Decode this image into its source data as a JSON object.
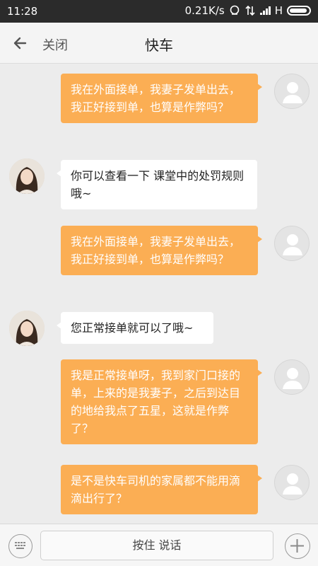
{
  "status_bar": {
    "time": "11:28",
    "network_speed": "0.21K/s",
    "network_type": "H",
    "icons": [
      "qq-icon",
      "data-arrows-icon",
      "signal-icon",
      "battery-icon"
    ]
  },
  "header": {
    "back_icon": "arrow-left-icon",
    "close_label": "关闭",
    "title": "快车"
  },
  "messages": [
    {
      "sender": "user",
      "avatar": "default-user-avatar",
      "text": "我在外面接单，我妻子发单出去，我正好接到单，也算是作弊吗？"
    },
    {
      "sender": "agent",
      "avatar": "service-agent-photo",
      "text": "你可以查看一下 课堂中的处罚规则哦~"
    },
    {
      "sender": "user",
      "avatar": "default-user-avatar",
      "text": "我在外面接单，我妻子发单出去，我正好接到单，也算是作弊吗？"
    },
    {
      "sender": "agent",
      "avatar": "service-agent-photo",
      "text": "您正常接单就可以了哦~"
    },
    {
      "sender": "user",
      "avatar": "default-user-avatar",
      "text": "我是正常接单呀，我到家门口接的单，上来的是我妻子，之后到达目的地给我点了五星，这就是作弊了？"
    },
    {
      "sender": "user",
      "avatar": "default-user-avatar",
      "text": "是不是快车司机的家属都不能用滴滴出行了？"
    }
  ],
  "input_bar": {
    "keyboard_icon": "keyboard-icon",
    "voice_button_label": "按住 说话",
    "plus_icon": "plus-icon"
  },
  "colors": {
    "outgoing_bubble": "#fbae54",
    "incoming_bubble": "#ffffff",
    "background": "#ececec"
  }
}
